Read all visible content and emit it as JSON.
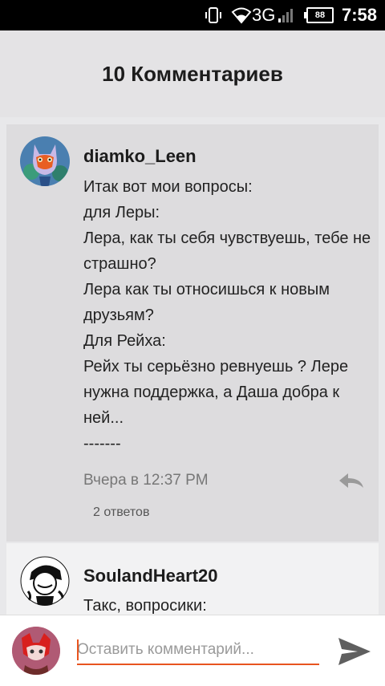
{
  "status_bar": {
    "network": "3G",
    "battery": "88",
    "time": "7:58"
  },
  "header": {
    "title": "10 Комментариев"
  },
  "comments": [
    {
      "username": "diamko_Leen",
      "lines": [
        "Итак вот мои вопросы:",
        "для Леры:",
        "Лера, как ты себя чувствуешь, тебе не страшно?",
        "Лера как ты относишься к новым друзьям?",
        "Для Рейха:",
        "Рейх ты серьёзно ревнуешь ? Лере нужна поддержка, а Даша добра к ней...",
        "-------"
      ],
      "timestamp": "Вчера в 12:37 PM",
      "replies": "2 ответов"
    },
    {
      "username": "SoulandHeart20",
      "lines": [
        "Такс, вопросики:"
      ]
    }
  ],
  "input": {
    "placeholder": "Оставить комментарий..."
  },
  "colors": {
    "accent": "#e8541f",
    "header_bg": "#e4e3e5",
    "card_bg": "#dddcde"
  },
  "icons": {
    "status": [
      "vibrate-icon",
      "wifi-icon",
      "signal-icon",
      "battery-icon"
    ],
    "reply": "reply-arrow-icon",
    "send": "send-icon"
  }
}
